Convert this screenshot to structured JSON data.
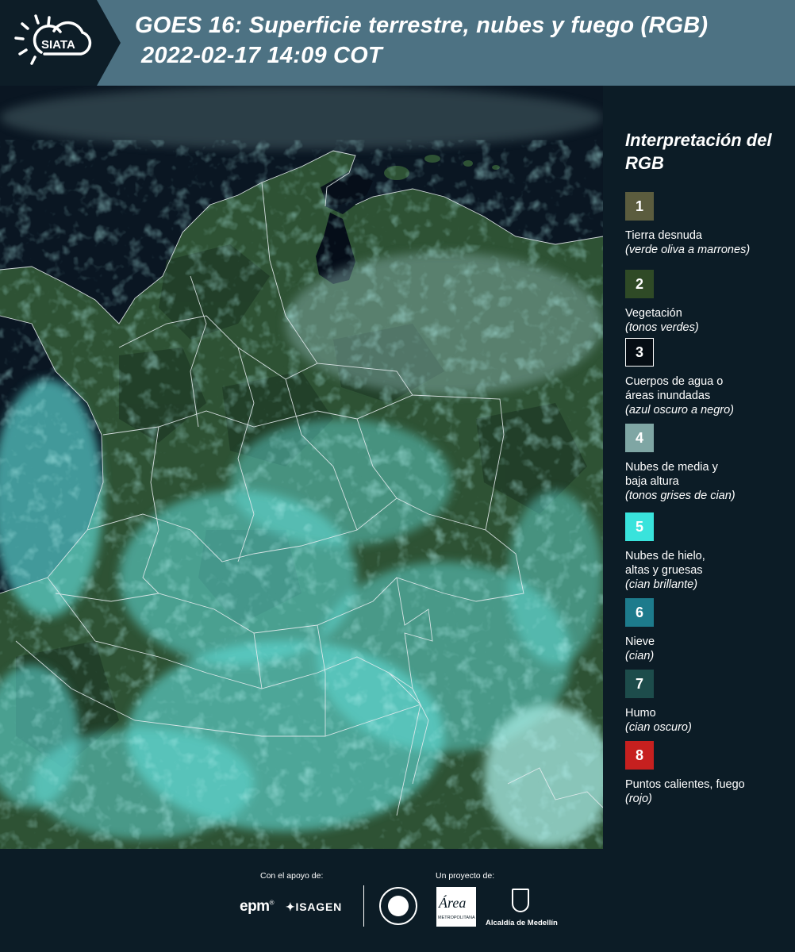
{
  "header": {
    "logo_text": "SIATA",
    "title": "GOES 16: Superficie terrestre, nubes y fuego (RGB)",
    "datetime": "2022-02-17 14:09 COT"
  },
  "map": {
    "colors": {
      "ocean": "#0a1622",
      "land": "#2e5234",
      "land_dark": "#1f3a26",
      "cloud": "#63e0dc",
      "cloud_light": "#a8ece6",
      "cloud_grey": "#8fb8b6",
      "water": "#050d18",
      "border": "#e6ecef"
    }
  },
  "legend": {
    "title": "Interpretación del RGB",
    "items": [
      {
        "num": "1",
        "color": "#5b5c3e",
        "label": "Tierra desnuda",
        "sub": "(verde oliva a marrones)"
      },
      {
        "num": "2",
        "color": "#2f4a26",
        "label": "Vegetación",
        "sub": "(tonos verdes)"
      },
      {
        "num": "3",
        "color": "#060d14",
        "label": "Cuerpos de agua o\náreas inundadas",
        "sub": "(azul oscuro a negro)"
      },
      {
        "num": "4",
        "color": "#7fa6a4",
        "label": "Nubes de media y\nbaja altura",
        "sub": "(tonos grises de cian)"
      },
      {
        "num": "5",
        "color": "#39e3dc",
        "label": "Nubes de hielo,\naltas y gruesas",
        "sub": "(cian brillante)"
      },
      {
        "num": "6",
        "color": "#1d7b8c",
        "label": "Nieve",
        "sub": "(cian)"
      },
      {
        "num": "7",
        "color": "#1d4c4b",
        "label": "Humo",
        "sub": "(cian oscuro)"
      },
      {
        "num": "8",
        "color": "#c6201f",
        "label": "Puntos calientes, fuego",
        "sub": "(rojo)"
      }
    ]
  },
  "footer": {
    "support_label": "Con el apoyo de:",
    "project_label": "Un proyecto de:",
    "epm": "epm",
    "epm_mark": "®",
    "isagen": "ISAGEN",
    "area_name": "Área",
    "area_sub": "METROPOLITANA",
    "alcaldia": "Alcaldía de Medellín"
  }
}
